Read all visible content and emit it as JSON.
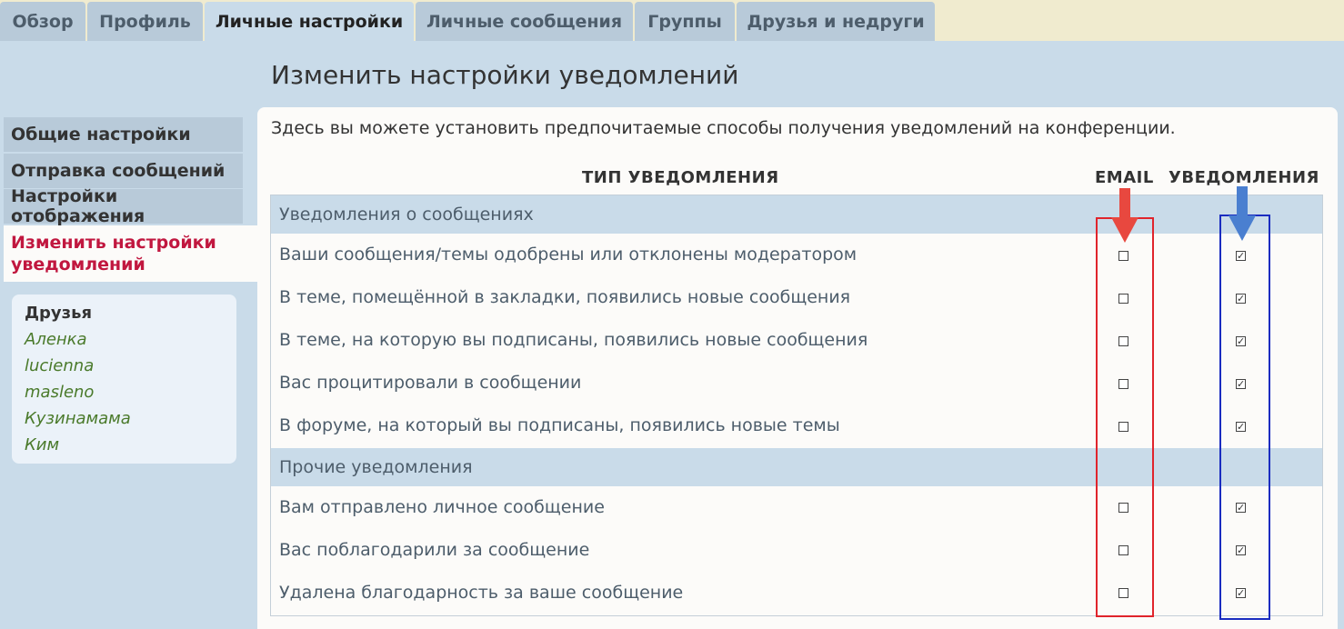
{
  "tabs": [
    {
      "label": "Обзор",
      "active": false
    },
    {
      "label": "Профиль",
      "active": false
    },
    {
      "label": "Личные настройки",
      "active": true
    },
    {
      "label": "Личные сообщения",
      "active": false
    },
    {
      "label": "Группы",
      "active": false
    },
    {
      "label": "Друзья и недруги",
      "active": false
    }
  ],
  "page_title": "Изменить настройки уведомлений",
  "sidebar": {
    "items": [
      {
        "label": "Общие настройки"
      },
      {
        "label": "Отправка сообщений"
      },
      {
        "label": "Настройки отображения"
      },
      {
        "label": "Изменить настройки уведомлений",
        "active": true
      }
    ],
    "friends": {
      "title": "Друзья",
      "list": [
        "Аленка",
        "lucienna",
        "masleno",
        "Кузинамама",
        "Ким"
      ]
    }
  },
  "intro": "Здесь вы можете установить предпочитаемые способы получения уведомлений на конференции.",
  "table": {
    "headers": {
      "type": "ТИП УВЕДОМЛЕНИЯ",
      "email": "EMAIL",
      "notify": "УВЕДОМЛЕНИЯ"
    },
    "groups": [
      {
        "title": "Уведомления о сообщениях",
        "rows": [
          {
            "label": "Ваши сообщения/темы одобрены или отклонены модератором",
            "email": false,
            "notify": true
          },
          {
            "label": "В теме, помещённой в закладки, появились новые сообщения",
            "email": false,
            "notify": true
          },
          {
            "label": "В теме, на которую вы подписаны, появились новые сообщения",
            "email": false,
            "notify": true
          },
          {
            "label": "Вас процитировали в сообщении",
            "email": false,
            "notify": true
          },
          {
            "label": "В форуме, на который вы подписаны, появились новые темы",
            "email": false,
            "notify": true
          }
        ]
      },
      {
        "title": "Прочие уведомления",
        "rows": [
          {
            "label": "Вам отправлено личное сообщение",
            "email": false,
            "notify": true
          },
          {
            "label": "Вас поблагодарили за сообщение",
            "email": false,
            "notify": true
          },
          {
            "label": "Удалена благодарность за ваше сообщение",
            "email": false,
            "notify": true
          }
        ]
      }
    ]
  },
  "colors": {
    "highlight_email": "#e0242c",
    "highlight_notify": "#1a2cc0",
    "arrow_red": "#e8483f",
    "arrow_blue": "#4a7fd0"
  }
}
